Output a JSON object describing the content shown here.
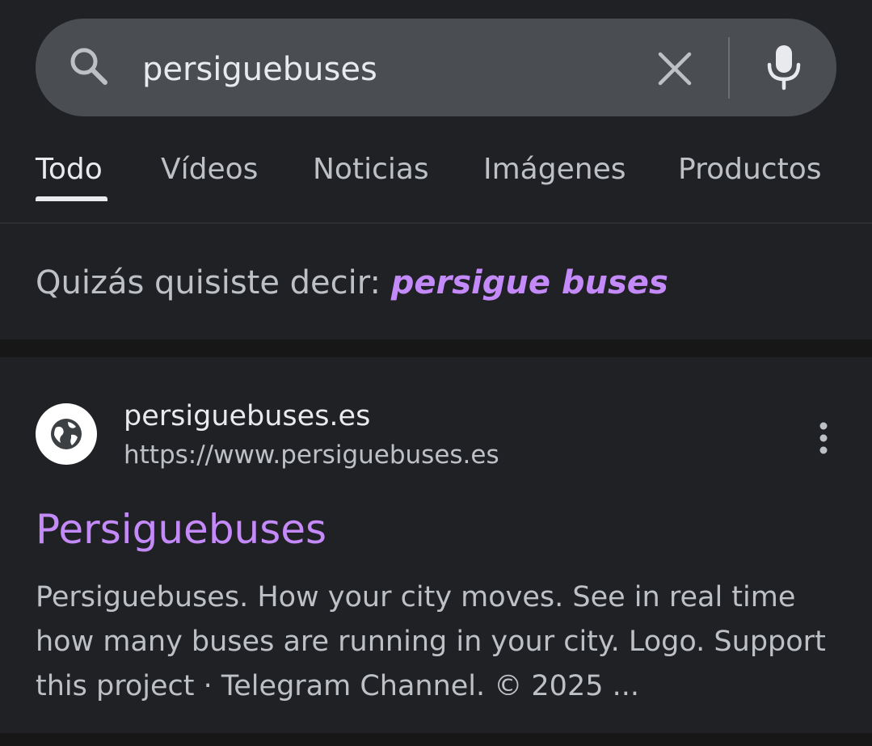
{
  "search": {
    "query": "persiguebuses",
    "icon": "search-icon",
    "clear_icon": "close-icon",
    "voice_icon": "microphone-icon"
  },
  "tabs": [
    {
      "label": "Todo",
      "active": true
    },
    {
      "label": "Vídeos",
      "active": false
    },
    {
      "label": "Noticias",
      "active": false
    },
    {
      "label": "Imágenes",
      "active": false
    },
    {
      "label": "Productos",
      "active": false
    }
  ],
  "suggestion": {
    "prefix": "Quizás quisiste decir: ",
    "link": "persigue buses"
  },
  "result": {
    "site_name": "persiguebuses.es",
    "url": "https://www.persiguebuses.es",
    "favicon_icon": "globe-icon",
    "menu_icon": "more-vert-icon",
    "title": "Persiguebuses",
    "snippet": "Persiguebuses. How your city moves. See in real time how many buses are running in your city. Logo. Support this project · Telegram Channel. © 2025 ..."
  },
  "colors": {
    "background": "#202124",
    "search_bar": "#4a4d52",
    "primary_text": "#e8eaed",
    "secondary_text": "#bdc1c6",
    "link_visited": "#c58af9"
  }
}
